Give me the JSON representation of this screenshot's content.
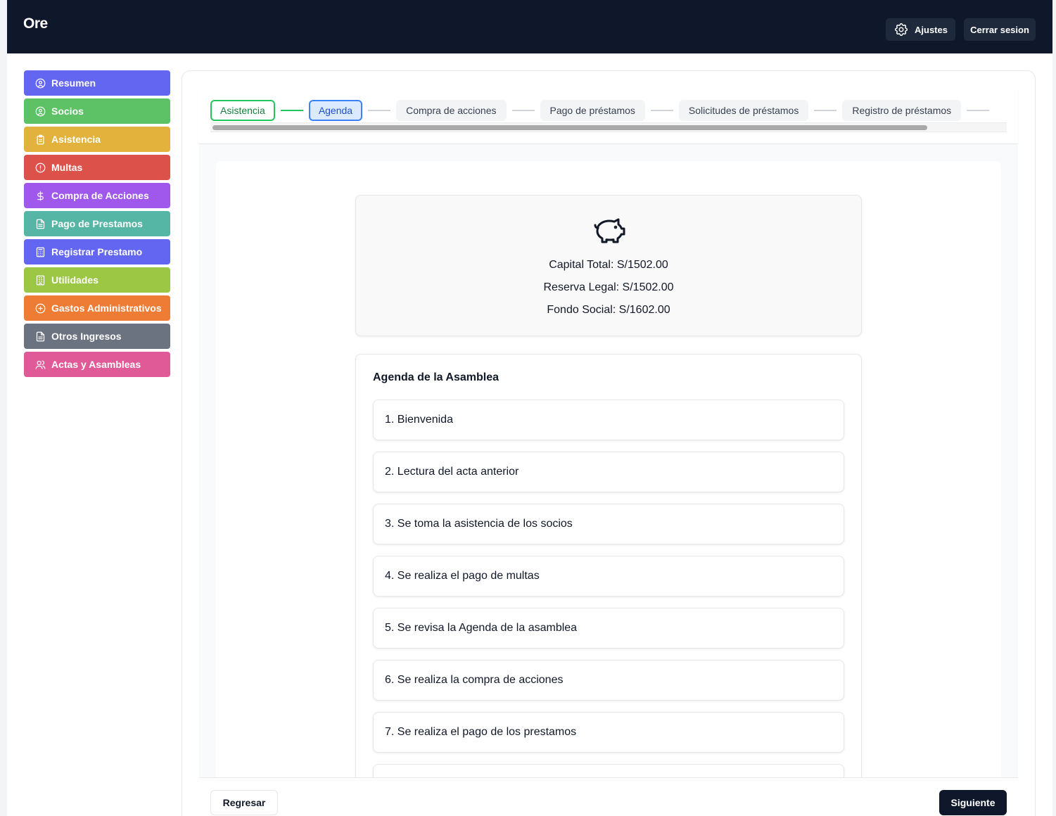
{
  "header": {
    "brand": "Ore",
    "settings_label": "Ajustes",
    "logout_label": "Cerrar sesion",
    "background": "#0f172a"
  },
  "sidebar": {
    "items": [
      {
        "label": "Resumen",
        "icon": "user-circle-icon",
        "color": "#6366f1"
      },
      {
        "label": "Socios",
        "icon": "user-circle-icon",
        "color": "#5cc265"
      },
      {
        "label": "Asistencia",
        "icon": "clipboard-icon",
        "color": "#e3b23c"
      },
      {
        "label": "Multas",
        "icon": "alert-circle-icon",
        "color": "#dc524a"
      },
      {
        "label": "Compra de Acciones",
        "icon": "dollar-icon",
        "color": "#a057ec"
      },
      {
        "label": "Pago de Prestamos",
        "icon": "document-icon",
        "color": "#55b6a6"
      },
      {
        "label": "Registrar Prestamo",
        "icon": "calculator-icon",
        "color": "#6366f1"
      },
      {
        "label": "Utilidades",
        "icon": "building-icon",
        "color": "#9bc744"
      },
      {
        "label": "Gastos Administrativos",
        "icon": "plus-circle-icon",
        "color": "#ee7c34"
      },
      {
        "label": "Otros Ingresos",
        "icon": "document-icon",
        "color": "#6b7280"
      },
      {
        "label": "Actas y Asambleas",
        "icon": "users-icon",
        "color": "#e05a98"
      }
    ]
  },
  "stepper": {
    "steps": [
      {
        "label": "Asistencia",
        "state": "done"
      },
      {
        "label": "Agenda",
        "state": "active"
      },
      {
        "label": "Compra de acciones",
        "state": "pending"
      },
      {
        "label": "Pago de préstamos",
        "state": "pending"
      },
      {
        "label": "Solicitudes de préstamos",
        "state": "pending"
      },
      {
        "label": "Registro de préstamos",
        "state": "pending"
      }
    ]
  },
  "summary": {
    "icon": "piggy-bank-icon",
    "capital": "Capital Total: S/1502.00",
    "reserva": "Reserva Legal: S/1502.00",
    "fondo": "Fondo Social: S/1602.00"
  },
  "agenda": {
    "title": "Agenda de la Asamblea",
    "items": [
      "1. Bienvenida",
      "2. Lectura del acta anterior",
      "3. Se toma la asistencia de los socios",
      "4. Se realiza el pago de multas",
      "5. Se revisa la Agenda de la asamblea",
      "6. Se realiza la compra de acciones",
      "7. Se realiza el pago de los prestamos"
    ]
  },
  "footer": {
    "back_label": "Regresar",
    "next_label": "Siguiente"
  }
}
